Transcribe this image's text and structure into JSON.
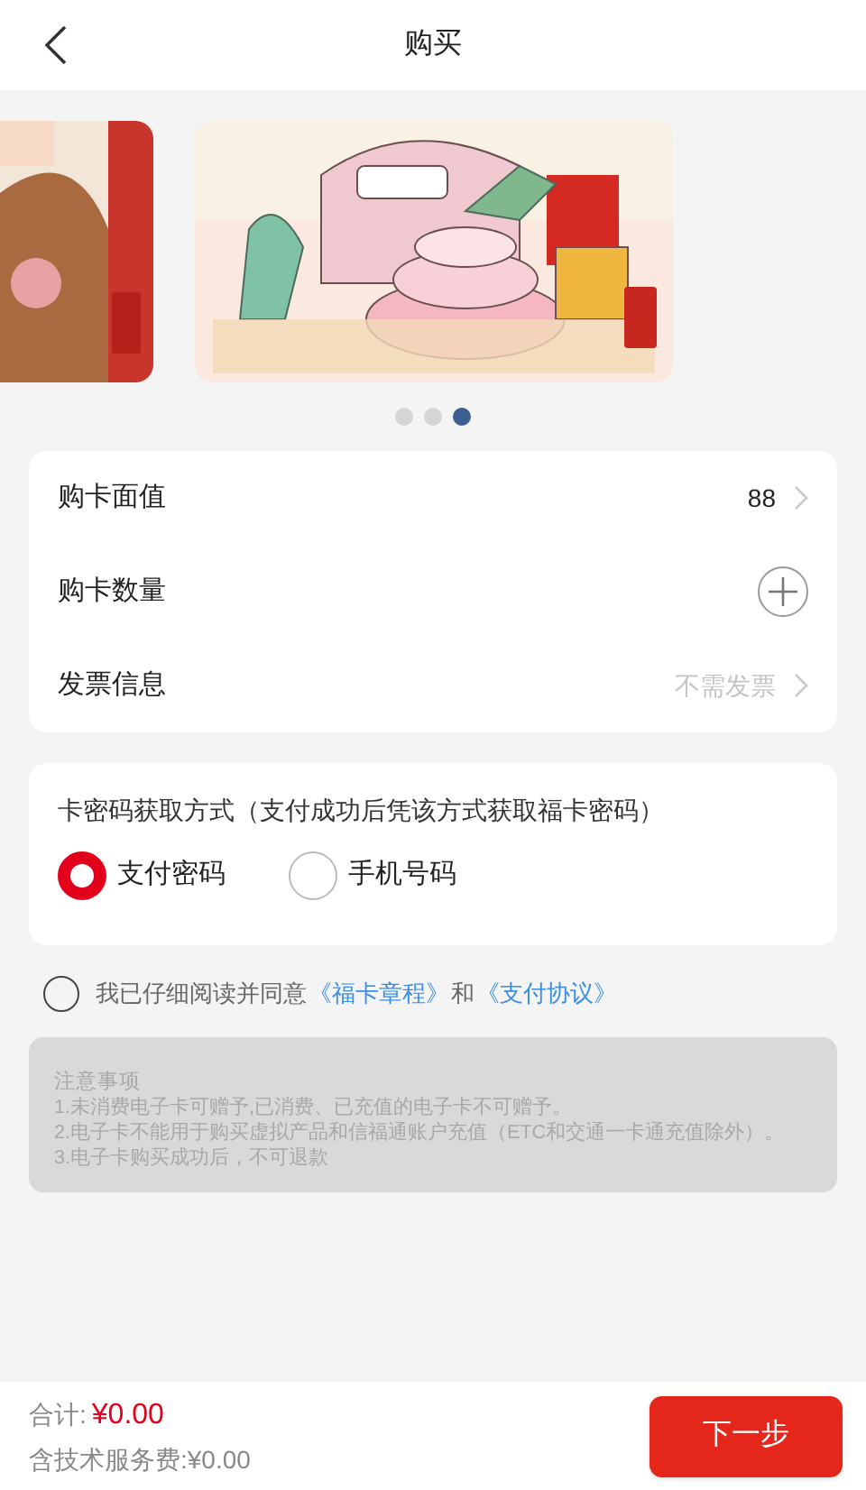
{
  "header": {
    "title": "购买"
  },
  "carousel": {
    "dots": [
      {
        "selected": false
      },
      {
        "selected": false
      },
      {
        "selected": true
      }
    ]
  },
  "purchase_rows": [
    {
      "kind": "value",
      "label": "购卡面值",
      "value": "88",
      "muted": false
    },
    {
      "kind": "stepper",
      "label": "购卡数量"
    },
    {
      "kind": "value",
      "label": "发票信息",
      "value": "不需发票",
      "muted": true
    }
  ],
  "delivery": {
    "title": "卡密码获取方式（支付成功后凭该方式获取福卡密码）",
    "options": [
      {
        "label": "支付密码",
        "selected": true
      },
      {
        "label": "手机号码",
        "selected": false
      }
    ]
  },
  "agreement": {
    "checked": false,
    "parts": [
      {
        "kind": "text",
        "text": "我已仔细阅读并同意"
      },
      {
        "kind": "link",
        "text": "《福卡章程》"
      },
      {
        "kind": "text",
        "text": "和"
      },
      {
        "kind": "link",
        "text": "《支付协议》"
      }
    ]
  },
  "notice": {
    "title": "注意事项",
    "lines": [
      "1.未消费电子卡可赠予,已消费、已充值的电子卡不可赠予。",
      "2.电子卡不能用于购买虚拟产品和信福通账户充值（ETC和交通一卡通充值除外）。",
      "3.电子卡购买成功后，不可退款"
    ]
  },
  "footer": {
    "total_label": "合计:",
    "total": "¥0.00",
    "fee": "含技术服务费:¥0.00",
    "button": "下一步"
  }
}
